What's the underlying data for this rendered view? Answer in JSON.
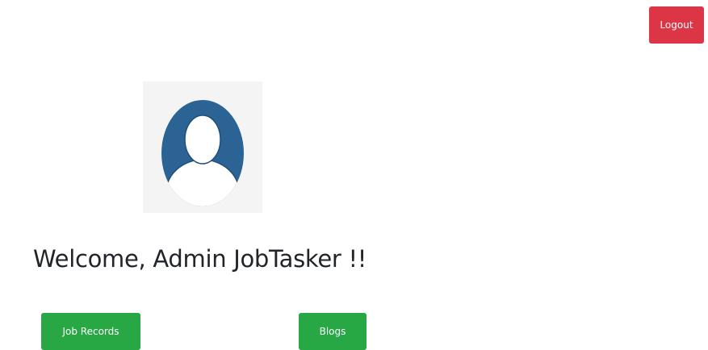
{
  "header": {
    "logout_label": "Logout"
  },
  "profile": {
    "avatar_icon": "user-avatar-icon",
    "avatar_color": "#2a6394",
    "welcome_text": "Welcome, Admin JobTasker !!"
  },
  "actions": {
    "job_records_label": "Job Records",
    "blogs_label": "Blogs"
  },
  "colors": {
    "danger": "#dc3545",
    "success": "#28a745"
  }
}
